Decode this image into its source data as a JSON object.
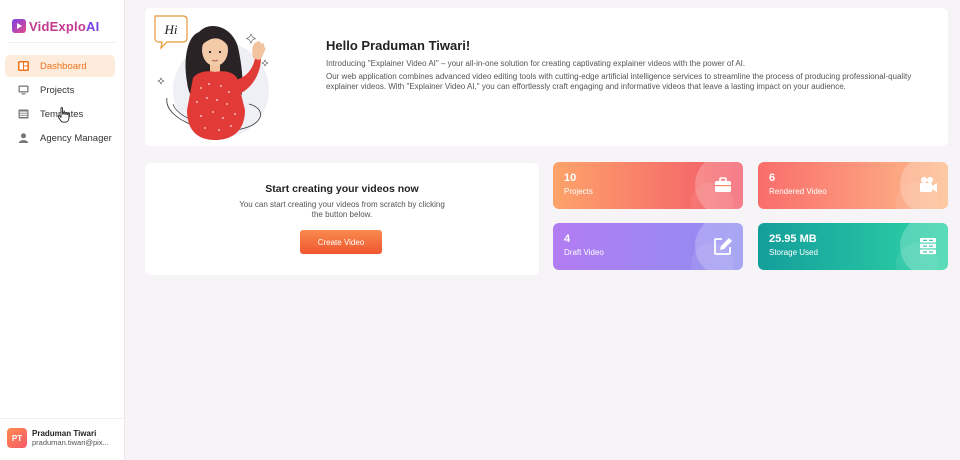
{
  "brand": {
    "name_main": "VidExplo",
    "name_ai": "AI"
  },
  "sidebar": {
    "items": [
      {
        "label": "Dashboard",
        "icon": "dashboard-icon",
        "active": true
      },
      {
        "label": "Projects",
        "icon": "monitor-icon",
        "active": false
      },
      {
        "label": "Templates",
        "icon": "template-icon",
        "active": false
      },
      {
        "label": "Agency Manager",
        "icon": "user-icon",
        "active": false
      }
    ]
  },
  "user": {
    "initials": "PT",
    "name": "Praduman Tiwari",
    "email": "praduman.tiwari@pix..."
  },
  "welcome": {
    "bubble": "Hi",
    "title": "Hello Praduman Tiwari!",
    "intro": "Introducing \"Explainer Video AI\" – your all-in-one solution for creating captivating explainer videos with the power of AI.",
    "body": "Our web application combines advanced video editing tools with cutting-edge artificial intelligence services to streamline the process of producing professional-quality explainer videos. With \"Explainer Video AI,\" you can effortlessly craft engaging and informative videos that leave a lasting impact on your audience."
  },
  "start": {
    "title": "Start creating your videos now",
    "subtitle": "You can start creating your videos from scratch by clicking the button below.",
    "button": "Create Video"
  },
  "stats": [
    {
      "value": "10",
      "label": "Projects",
      "icon": "briefcase-icon"
    },
    {
      "value": "6",
      "label": "Rendered Video",
      "icon": "video-camera-icon"
    },
    {
      "value": "4",
      "label": "Draft Video",
      "icon": "edit-icon"
    },
    {
      "value": "25.95 MB",
      "label": "Storage Used",
      "icon": "server-icon"
    }
  ],
  "colors": {
    "accent": "#f0731c",
    "projects_gradient": [
      "#fda36a",
      "#f3596a"
    ],
    "rendered_gradient": [
      "#fa6d6b",
      "#fdbb8a"
    ],
    "draft_gradient": [
      "#b27cf2",
      "#8f8ef0"
    ],
    "storage_gradient": [
      "#139e9b",
      "#2ed3a6"
    ]
  }
}
